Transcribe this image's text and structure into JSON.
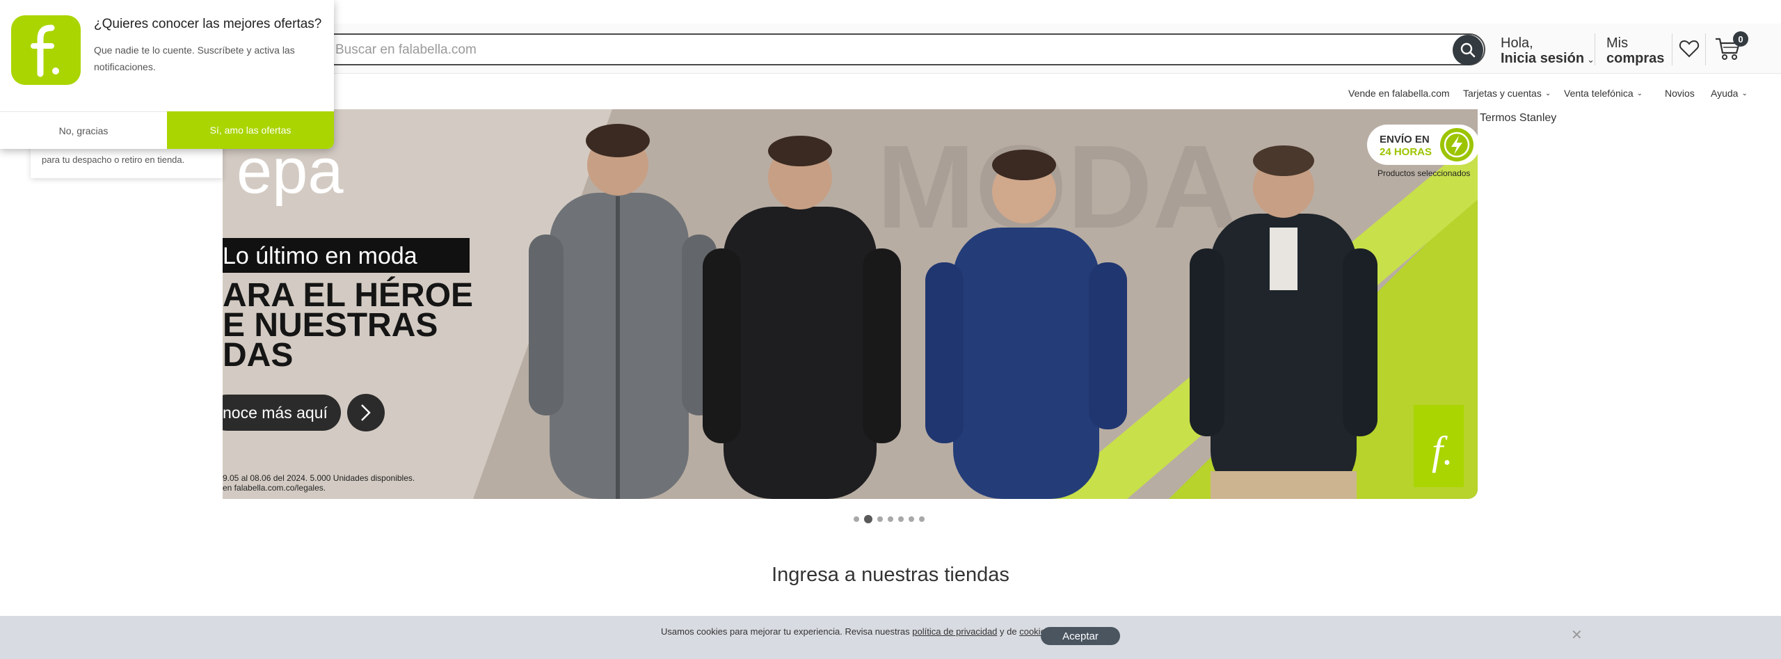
{
  "search": {
    "placeholder": "Buscar en falabella.com"
  },
  "account": {
    "greeting": "Hola,",
    "login": "Inicia sesión"
  },
  "orders": {
    "line1": "Mis",
    "line2": "compras"
  },
  "cart": {
    "count": "0"
  },
  "secondary_nav": {
    "sell": "Vende en falabella.com",
    "cards": "Tarjetas y cuentas",
    "phone": "Venta telefónica",
    "novios": "Novios",
    "help": "Ayuda"
  },
  "side_link": "Termos Stanley",
  "banner": {
    "brand_partial": "epa",
    "tag": "Lo último en moda",
    "headline": [
      "ARA EL HÉROE",
      "E NUESTRAS",
      "DAS"
    ],
    "cta": "noce más aquí",
    "legal_1": "9.05 al 08.06 del 2024. 5.000 Unidades disponibles.",
    "legal_2": "en falabella.com.co/legales.",
    "bg_word": "MODA",
    "shipping_line1": "ENVÍO EN",
    "shipping_line2": "24 HORAS",
    "shipping_note": "Productos seleccionados",
    "dots_total": 7,
    "dots_active": 1
  },
  "stores_title": "Ingresa a nuestras tiendas",
  "underlying_card_text": "para tu despacho o retiro en tienda.",
  "notification": {
    "title": "¿Quieres conocer las mejores ofertas?",
    "body": "Que nadie te lo cuente. Suscríbete y activa las notificaciones.",
    "decline": "No, gracias",
    "accept": "Sí, amo las ofertas"
  },
  "cookie": {
    "text_before": "Usamos cookies para mejorar tu experiencia. Revisa nuestras ",
    "privacy_link": "política de privacidad",
    "text_middle": " y de ",
    "cookies_link": "cookies",
    "text_end": ".",
    "accept": "Aceptar"
  },
  "colors": {
    "brand_green": "#aad500",
    "dark": "#333a40"
  },
  "icons": [
    "search-icon",
    "heart-icon",
    "cart-icon",
    "close-icon",
    "chevron-down-icon",
    "chevron-right-icon",
    "lightning-icon",
    "falabella-logo-icon"
  ]
}
